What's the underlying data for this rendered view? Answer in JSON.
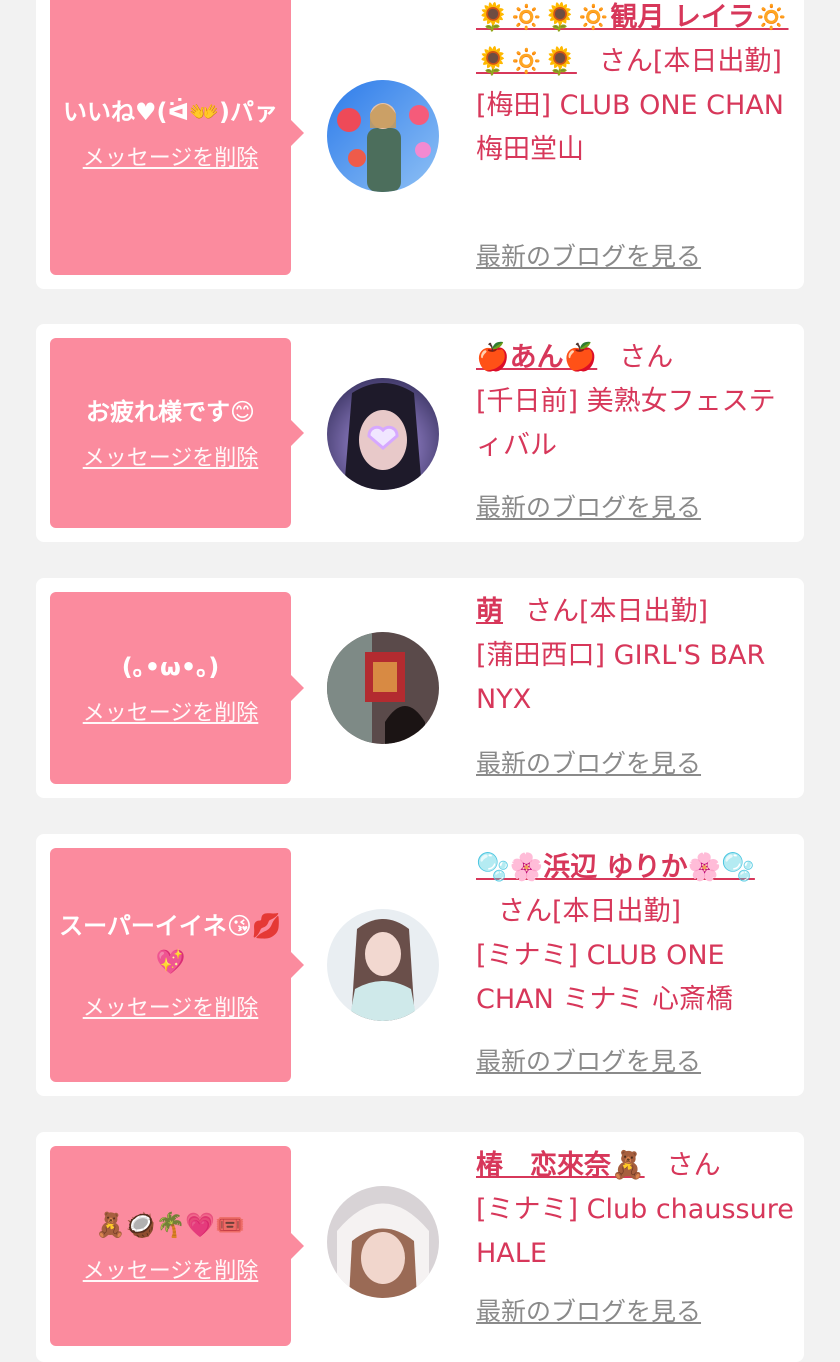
{
  "delete_label": "メッセージを削除",
  "blog_label": "最新のブログを見る",
  "san": "さん",
  "colors": {
    "accent": "#d7375a",
    "bubble": "#fb8b9e",
    "background": "#f2f2f2"
  },
  "entries": [
    {
      "message": "いいね♥(ᐛ👐)パァ",
      "name": "🌻🔅🌻🔅観月 レイラ🔅🌻🔅🌻",
      "status": "[本日出勤]",
      "location": "[梅田] CLUB ONE CHAN 梅田堂山"
    },
    {
      "message": "お疲れ様です😊",
      "name": "🍎あん🍎",
      "status": "",
      "location": "[千日前] 美熟女フェスティバル"
    },
    {
      "message": "(｡•ω•｡)",
      "name": "萌",
      "status": "[本日出勤]",
      "location": "[蒲田西口] GIRL'S BAR NYX"
    },
    {
      "message": "スーパーイイネ😘💋💖",
      "name": "🫧🌸浜辺 ゆりか🌸🫧",
      "status": "[本日出勤]",
      "location": "[ミナミ] CLUB ONE CHAN ミナミ 心斎橋"
    },
    {
      "message": "🧸🥥🌴💗🎟️",
      "name": "椿　恋來奈🧸",
      "status": "",
      "location": "[ミナミ] Club chaussure HALE"
    }
  ]
}
